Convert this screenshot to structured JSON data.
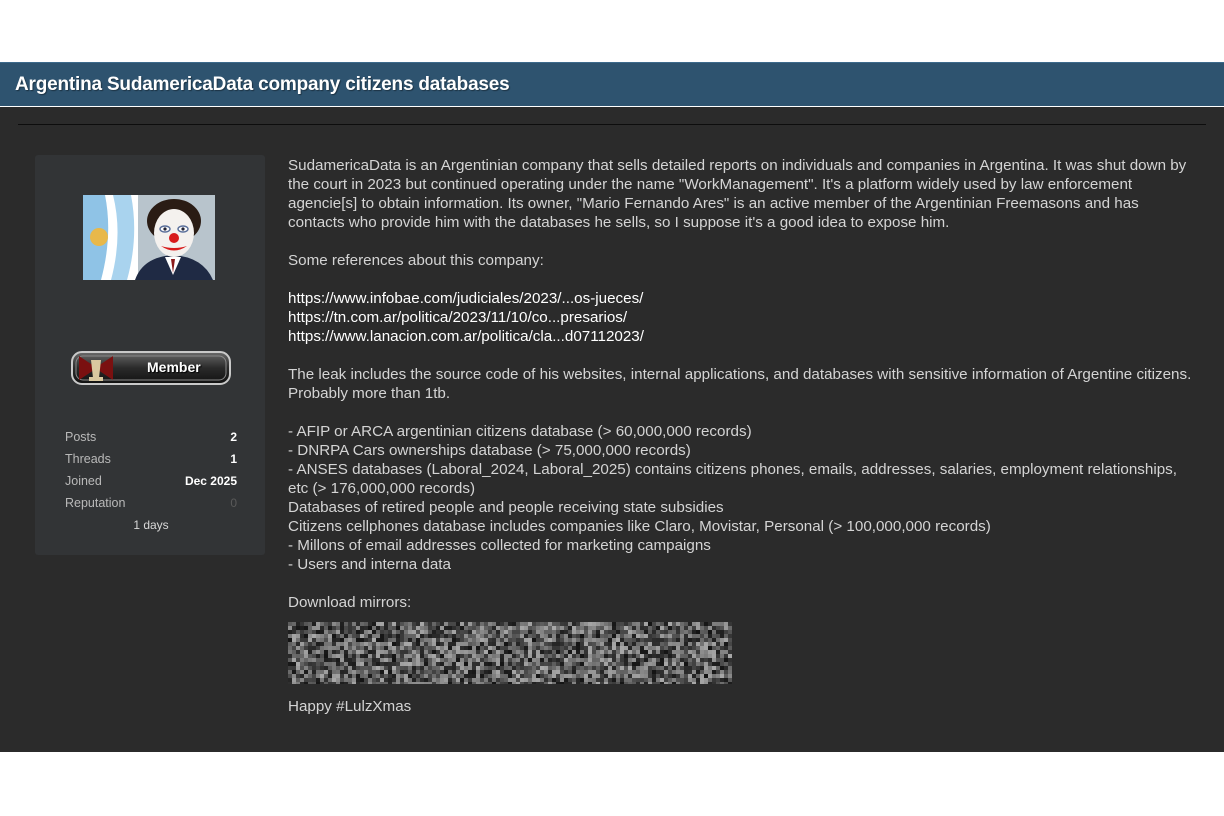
{
  "thread": {
    "title": "Argentina SudamericaData company citizens databases"
  },
  "user": {
    "rank": "Member",
    "stats": [
      {
        "label": "Posts",
        "value": "2"
      },
      {
        "label": "Threads",
        "value": "1"
      },
      {
        "label": "Joined",
        "value": "Dec 2025"
      },
      {
        "label": "Reputation",
        "value": "0"
      }
    ],
    "days": "1 days"
  },
  "post": {
    "intro": "SudamericaData is an Argentinian company that sells detailed reports on individuals and companies in Argentina. It was shut down by the court in 2023 but continued operating under the name \"WorkManagement\". It's a platform widely used by law enforcement agencie[s] to obtain information. Its owner, \"Mario Fernando Ares\" is an active member of the Argentinian Freemasons and has contacts who provide him with the databases he sells, so I suppose it's a good idea to expose him.",
    "references_heading": "Some references about this company:",
    "links": [
      "https://www.infobae.com/judiciales/2023/...os-jueces/",
      "https://tn.com.ar/politica/2023/11/10/co...presarios/",
      "https://www.lanacion.com.ar/politica/cla...d07112023/"
    ],
    "leak_summary": "The leak includes the source code of his websites, internal applications, and databases with sensitive information of Argentine citizens. Probably more than 1tb.",
    "leak_items": [
      "- AFIP or ARCA argentinian citizens database (> 60,000,000 records)",
      "- DNRPA Cars ownerships database (> 75,000,000 records)",
      "- ANSES databases (Laboral_2024, Laboral_2025) contains citizens phones, emails, addresses, salaries, employment relationships, etc (> 176,000,000 records)",
      "Databases of retired people and people receiving state subsidies",
      "Citizens cellphones database includes companies like Claro, Movistar, Personal (> 100,000,000 records)",
      "- Millons of email addresses collected for marketing campaigns",
      "- Users and interna data"
    ],
    "download_heading": "Download mirrors:",
    "signoff": "Happy #LulzXmas"
  },
  "colors": {
    "title_bar": "#2e536f",
    "post_background": "#2b2b2b",
    "user_card": "#323436",
    "link": "#ffffff"
  }
}
